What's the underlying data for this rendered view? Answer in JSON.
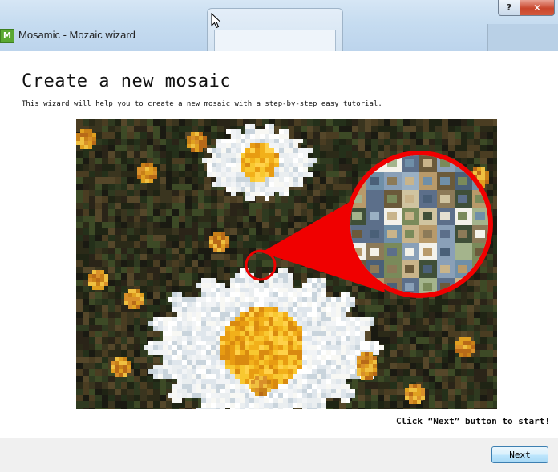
{
  "window": {
    "title": "Mosamic - Mozaic wizard",
    "app_icon_letter": "M",
    "help_glyph": "?",
    "close_glyph": "✕"
  },
  "wizard": {
    "heading": "Create a new mosaic",
    "description": "This wizard will help you to create a new mosaic with a step-by-step easy tutorial.",
    "hint": "Click “Next” button to start!"
  },
  "footer": {
    "next_label": "Next"
  },
  "colors": {
    "accent_red": "#f00000",
    "button_border": "#3c7fb1"
  }
}
